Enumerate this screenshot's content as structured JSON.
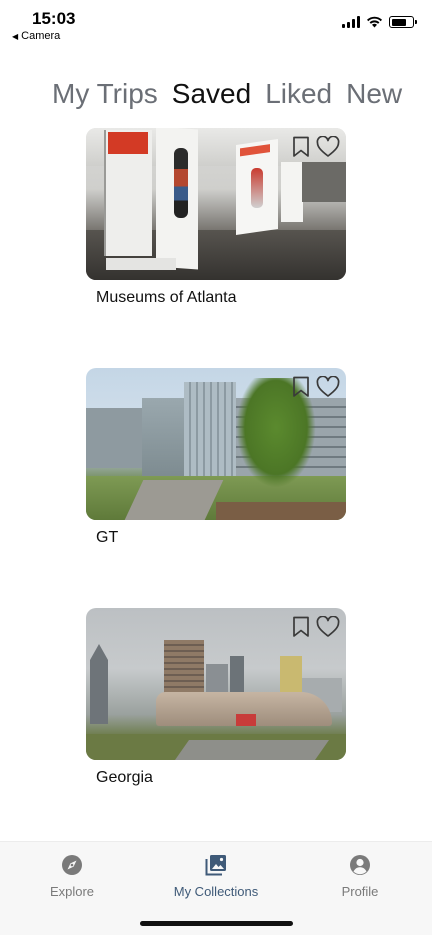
{
  "status_bar": {
    "time": "15:03",
    "back_label": "Camera",
    "back_glyph": "◀"
  },
  "tabs": [
    {
      "label": "My Trips",
      "active": false
    },
    {
      "label": "Saved",
      "active": true
    },
    {
      "label": "Liked",
      "active": false
    },
    {
      "label": "New",
      "active": false
    }
  ],
  "collections": [
    {
      "title": "Museums of Atlanta",
      "image": "museum-interior-guitars",
      "icons": [
        "bookmark-icon",
        "heart-icon"
      ]
    },
    {
      "title": "GT",
      "image": "campus-building-with-tree",
      "icons": [
        "bookmark-icon",
        "heart-icon"
      ]
    },
    {
      "title": "Georgia",
      "image": "atlanta-skyline-plaza",
      "icons": [
        "bookmark-icon",
        "heart-icon"
      ]
    }
  ],
  "bottom_nav": {
    "items": [
      {
        "label": "Explore",
        "icon": "compass-icon",
        "active": false
      },
      {
        "label": "My Collections",
        "icon": "photo-gallery-icon",
        "active": true
      },
      {
        "label": "Profile",
        "icon": "user-circle-icon",
        "active": false
      }
    ]
  },
  "colors": {
    "tab_inactive": "#6b6f76",
    "tab_active": "#111111",
    "nav_active": "#3f5a78",
    "nav_inactive": "#7a7a7a"
  }
}
